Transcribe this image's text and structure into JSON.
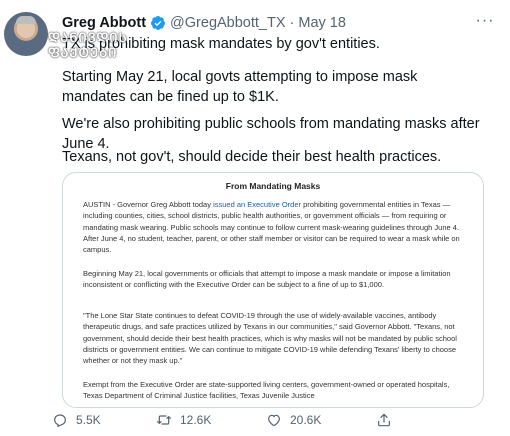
{
  "tweet": {
    "author_name": "Greg Abbott",
    "handle": "@GregAbbott_TX",
    "separator": "·",
    "date": "May 18",
    "more_label": "···",
    "lines": [
      "TX is prohibiting mask mandates by gov't entities.",
      "Starting May 21, local govts attempting to impose mask mandates can be fined up to $1K.",
      "We're also prohibiting public schools from mandating masks after June 4.",
      "Texans, not gov't, should decide their best health practices."
    ]
  },
  "watermark": {
    "text": "ᲓᲐᲜᲘᲕᲓᲘᲡ ᲤᲐᲥᲢᲔᲑᲘ"
  },
  "document": {
    "title": "From Mandating Masks",
    "p1_before": "AUSTIN - Governor Greg Abbott today ",
    "p1_link": "issued an Executive Order",
    "p1_after": " prohibiting governmental entities in Texas — including counties, cities, school districts, public health authorities, or government officials — from requiring or mandating mask wearing. Public schools may continue to follow current mask-wearing guidelines through June 4. After June 4, no student, teacher, parent, or other staff member or visitor can be required to wear a mask while on campus.",
    "p2": "Beginning May 21, local governments or officials that attempt to impose a mask mandate or impose a limitation inconsistent or conflicting with the Executive Order can be subject to a fine of up to $1,000.",
    "p3": "\"The Lone Star State continues to defeat COVID-19 through the use of widely-available vaccines, antibody therapeutic drugs, and safe practices utilized by Texans in our communities,\" said Governor Abbott. \"Texans, not government, should decide their best health practices, which is why masks will not be mandated by public school districts or government entities. We can continue to mitigate COVID-19 while defending Texans' liberty to choose whether or not they mask up.\"",
    "p4": "Exempt from the Executive Order are state-supported living centers, government-owned or operated hospitals, Texas Department of Criminal Justice facilities, Texas Juvenile Justice"
  },
  "actions": {
    "replies": "5.5K",
    "retweets": "12.6K",
    "likes": "20.6K"
  },
  "colors": {
    "verified": "#1d9bf0",
    "muted": "#536471",
    "border": "#cfd9de",
    "link": "#1a5fb4"
  }
}
